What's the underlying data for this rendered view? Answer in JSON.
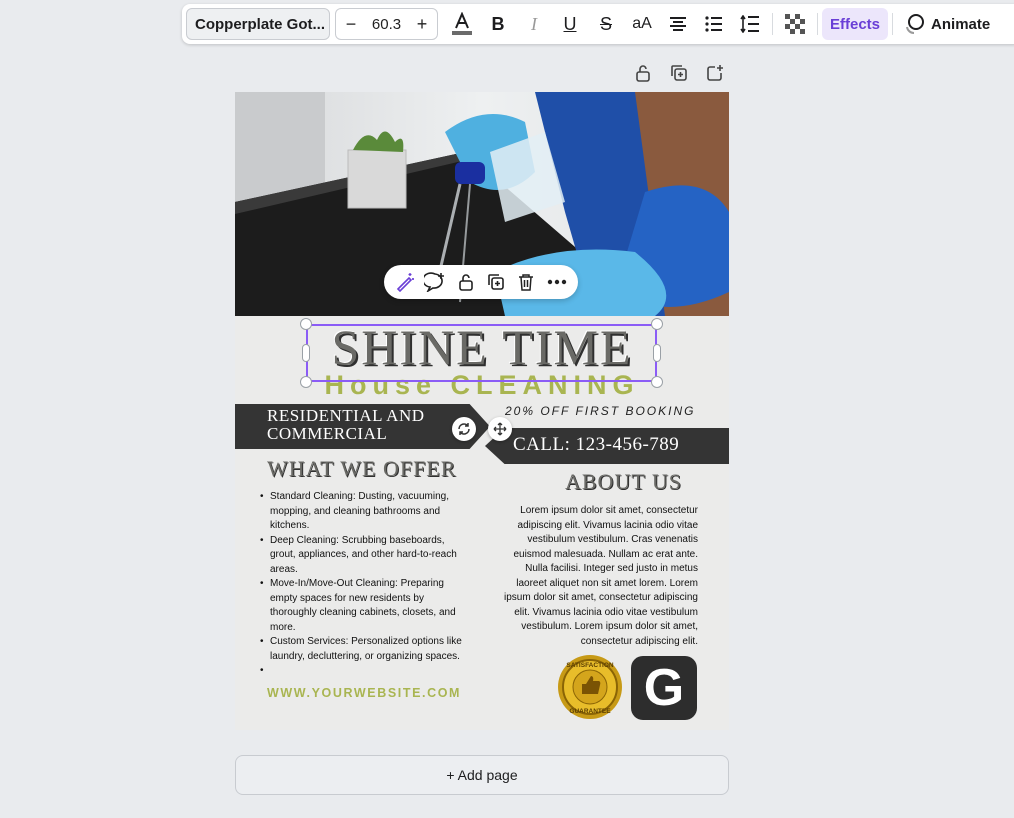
{
  "toolbar": {
    "font_name": "Copperplate Got...",
    "font_size": "60.3",
    "minus": "−",
    "plus": "+",
    "bold": "B",
    "italic": "I",
    "underline": "U",
    "strike": "S",
    "case": "aA",
    "effects": "Effects",
    "animate": "Animate",
    "colors": {
      "accent": "#6a3fd6",
      "effects_bg": "#ece6fb"
    }
  },
  "page_actions": [
    "lock-icon",
    "duplicate-page-icon",
    "add-page-icon"
  ],
  "floating_toolbar": [
    "magic-edit-icon",
    "comment-icon",
    "lock-icon",
    "duplicate-icon",
    "delete-icon",
    "more-icon"
  ],
  "flyer": {
    "title": "SHINE TIME",
    "subtitle": "House CLEANING",
    "ribbon_left_line1": "RESIDENTIAL AND",
    "ribbon_left_line2": "COMMERCIAL",
    "discount": "20% OFF FIRST BOOKING",
    "call": "CALL: 123-456-789",
    "offer_heading": "WHAT WE OFFER",
    "about_heading": "ABOUT US",
    "offers": [
      "Standard Cleaning: Dusting, vacuuming, mopping, and cleaning bathrooms and kitchens.",
      "Deep Cleaning: Scrubbing baseboards, grout, appliances, and other hard-to-reach areas.",
      "Move-In/Move-Out Cleaning: Preparing empty spaces for new residents by thoroughly cleaning cabinets, closets, and more.",
      "Custom Services: Personalized options like laundry, decluttering, or organizing spaces.",
      ""
    ],
    "about_text": "Lorem ipsum dolor sit amet, consectetur adipiscing elit. Vivamus lacinia odio vitae vestibulum vestibulum. Cras venenatis euismod malesuada. Nullam ac erat ante. Nulla facilisi. Integer sed justo in metus laoreet aliquet non sit amet lorem. Lorem ipsum dolor sit amet, consectetur adipiscing elit. Vivamus lacinia odio vitae vestibulum vestibulum. Lorem ipsum dolor sit amet, consectetur adipiscing elit.",
    "website": "WWW.YOURWEBSITE.COM",
    "badge_line1": "SATISFACTION",
    "badge_line2": "GUARANTEE",
    "g_letter": "G",
    "colors": {
      "olive": "#a9b551",
      "dark": "#343434",
      "selection": "#8b5cf6"
    }
  },
  "add_page": "+ Add page"
}
